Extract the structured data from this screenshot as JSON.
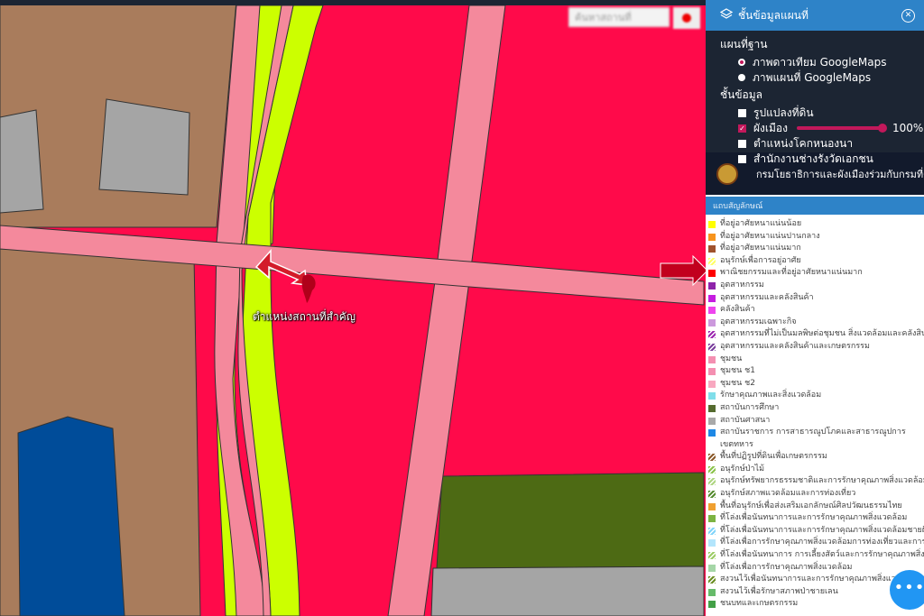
{
  "map": {
    "location_label": "ตำแหน่งสถานที่สำคัญ",
    "search_placeholder": "ค้นหาสถานที่"
  },
  "panel": {
    "title": "ชั้นข้อมูลแผนที่",
    "basemap_title": "แผนที่ฐาน",
    "basemaps": [
      {
        "label": "ภาพดาวเทียม GoogleMaps",
        "selected": true
      },
      {
        "label": "ภาพแผนที่ GoogleMaps",
        "selected": false
      }
    ],
    "layers_title": "ชั้นข้อมูล",
    "layers": [
      {
        "label": "รูปแปลงที่ดิน",
        "checked": false
      },
      {
        "label": "ผังเมือง",
        "checked": true,
        "opacity": "100%"
      },
      {
        "label": "ตำแหน่งโคกหนองนา",
        "checked": false
      },
      {
        "label": "สำนักงานช่างรังวัดเอกชน",
        "checked": false
      }
    ],
    "department": "กรมโยธาธิการและผังเมืองร่วมกับกรมที่ดิน",
    "legend_title": "แถบสัญลักษณ์",
    "legend": [
      {
        "label": "ที่อยู่อาศัยหนาแน่นน้อย",
        "color": "#ffff00"
      },
      {
        "label": "ที่อยู่อาศัยหนาแน่นปานกลาง",
        "color": "#f7941d"
      },
      {
        "label": "ที่อยู่อาศัยหนาแน่นมาก",
        "color": "#a0522d"
      },
      {
        "label": "อนุรักษ์เพื่อการอยู่อาศัย",
        "color": "#ffff66",
        "hatch": true
      },
      {
        "label": "พาณิชยกรรมและที่อยู่อาศัยหนาแน่นมาก",
        "color": "#ff0000"
      },
      {
        "label": "อุตสาหกรรม",
        "color": "#8e24aa"
      },
      {
        "label": "อุตสาหกรรมและคลังสินค้า",
        "color": "#c51de0"
      },
      {
        "label": "คลังสินค้า",
        "color": "#ee44ee"
      },
      {
        "label": "อุตสาหกรรมเฉพาะกิจ",
        "color": "#cc99dd"
      },
      {
        "label": "อุตสาหกรรมที่ไม่เป็นมลพิษต่อชุมชน สิ่งแวดล้อมและคลังสินค้า",
        "color": "#9c27b0",
        "hatch": true
      },
      {
        "label": "อุตสาหกรรมและคลังสินค้าและเกษตรกรรม",
        "color": "#7b3f9e",
        "hatch": true
      },
      {
        "label": "ชุมชน",
        "color": "#f48fb1"
      },
      {
        "label": "ชุมชน ช1",
        "color": "#f48fb1"
      },
      {
        "label": "ชุมชน ช2",
        "color": "#f8a8c0"
      },
      {
        "label": "รักษาคุณภาพและสิ่งแวดล้อม",
        "color": "#80deea"
      },
      {
        "label": "สถาบันการศึกษา",
        "color": "#556b2f"
      },
      {
        "label": "สถาบันศาสนา",
        "color": "#a9a9a9"
      },
      {
        "label": "สถาบันราชการ การสาธารณูปโภคและสาธารณูปการ เขตทหาร",
        "color": "#1e88e5"
      },
      {
        "label": "พื้นที่ปฏิรูปที่ดินเพื่อเกษตรกรรม",
        "color": "#8b5a2b",
        "hatch": true
      },
      {
        "label": "อนุรักษ์ป่าไม้",
        "color": "#8bc34a",
        "hatch": true
      },
      {
        "label": "อนุรักษ์ทรัพยากรธรรมชาติและการรักษาคุณภาพสิ่งแวดล้อม",
        "color": "#aed581",
        "hatch": true
      },
      {
        "label": "อนุรักษ์สภาพแวดล้อมและการท่องเที่ยว",
        "color": "#558b2f",
        "hatch": true
      },
      {
        "label": "พื้นที่อนุรักษ์เพื่อส่งเสริมเอกลักษณ์ศิลปวัฒนธรรมไทย",
        "color": "#f0a030"
      },
      {
        "label": "ที่โล่งเพื่อนันทนาการและการรักษาคุณภาพสิ่งแวดล้อม",
        "color": "#7cb342"
      },
      {
        "label": "ที่โล่งเพื่อนันทนาการและการรักษาคุณภาพสิ่งแวดล้อมชายฝั่งทะเล",
        "color": "#81d4fa",
        "hatch": true
      },
      {
        "label": "ที่โล่งเพื่อการรักษาคุณภาพสิ่งแวดล้อมการท่องเที่ยวและการประมง",
        "color": "#b3e5fc"
      },
      {
        "label": "ที่โล่งเพื่อนันทนาการ การเลี้ยงสัตว์และการรักษาคุณภาพสิ่งแวดล้อม",
        "color": "#9ccc65",
        "hatch": true
      },
      {
        "label": "ที่โล่งเพื่อการรักษาคุณภาพสิ่งแวดล้อม",
        "color": "#a5d6a7"
      },
      {
        "label": "สงวนไว้เพื่อนันทนาการและการรักษาคุณภาพสิ่งแวดล้อม",
        "color": "#6b8e23",
        "hatch": true
      },
      {
        "label": "สงวนไว้เพื่อรักษาสภาพป่าชายเลน",
        "color": "#66bb6a"
      },
      {
        "label": "ชนบทและเกษตรกรรม",
        "color": "#43a047"
      }
    ]
  },
  "colors": {
    "commercial": "#ff0a4a",
    "community": "#f4899c",
    "low_density": "#ccff00",
    "high_density": "#a97c5c",
    "religious": "#a5a5a5",
    "government": "#004c99",
    "education": "#4d6a14",
    "accent": "#2e83c8"
  },
  "fab_icon": "more-icon"
}
